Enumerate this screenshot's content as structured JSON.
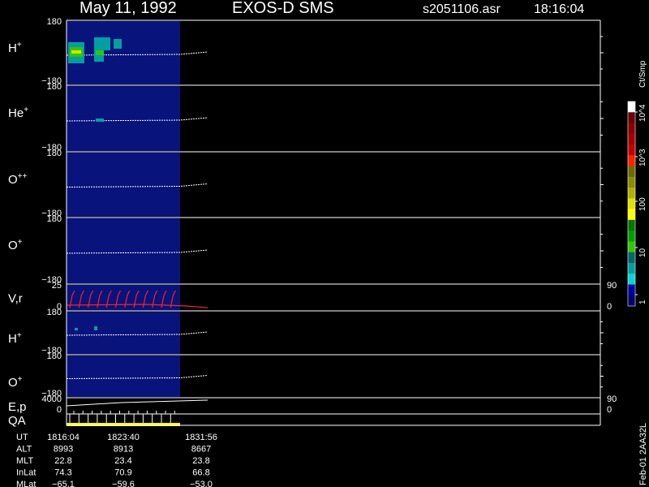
{
  "header": {
    "date": "May 11, 1992",
    "instrument": "EXOS-D SMS",
    "file": "s2051106.asr",
    "time": "18:16:04"
  },
  "colorbar": {
    "unit": "Ct/Smp",
    "ticks": [
      "10^4",
      "10^3",
      "100",
      "10",
      "1"
    ],
    "colors": [
      "#ffffff",
      "#6b0000",
      "#8c0000",
      "#a80000",
      "#c40000",
      "#ff2000",
      "#6b6b00",
      "#8c8c00",
      "#b0b000",
      "#e0e000",
      "#ffff00",
      "#007a00",
      "#00a000",
      "#30c800",
      "#006868",
      "#00a0a0",
      "#00d8d8",
      "#0000a0",
      "#00006a"
    ]
  },
  "colors": {
    "background": "#000000",
    "spectrogram_fill": "#08137c",
    "axis": "#ffffff",
    "velocity_trace": "#ff2020",
    "qa_bar": "#ffff00"
  },
  "chart_data": [
    {
      "type": "heatmap",
      "panel": "H+",
      "label": "H",
      "sup": "+",
      "ylim": [
        -180,
        180
      ],
      "ytick_top": "180",
      "ytick_bottom": "−180",
      "note_visible": "data only from 1816:04 to about 1821:00; high counts near 0°"
    },
    {
      "type": "heatmap",
      "panel": "He+",
      "label": "He",
      "sup": "+",
      "ylim": [
        -180,
        180
      ],
      "ytick_top": "180",
      "ytick_bottom": "−180"
    },
    {
      "type": "heatmap",
      "panel": "O++",
      "label": "O",
      "sup": "++",
      "ylim": [
        -180,
        180
      ],
      "ytick_top": "180",
      "ytick_bottom": "−180"
    },
    {
      "type": "heatmap",
      "panel": "O+",
      "label": "O",
      "sup": "+",
      "ylim": [
        -180,
        180
      ],
      "ytick_top": "180",
      "ytick_bottom": "−180"
    },
    {
      "type": "line",
      "panel": "V,r",
      "label": "V,r",
      "ylim": [
        0,
        25
      ],
      "ytick_top": "25",
      "ytick_bottom": "0",
      "right_ticks": [
        "90",
        "0"
      ]
    },
    {
      "type": "heatmap",
      "panel": "H+ (2)",
      "label": "H",
      "sup": "+",
      "ylim": [
        -180,
        180
      ],
      "ytick_top": "180",
      "ytick_bottom": "−180"
    },
    {
      "type": "heatmap",
      "panel": "O+ (2)",
      "label": "O",
      "sup": "+",
      "ylim": [
        -180,
        180
      ],
      "ytick_top": "180",
      "ytick_bottom": "−180"
    },
    {
      "type": "line",
      "panel": "E,p",
      "label": "E,p",
      "ylim": [
        0,
        4000
      ],
      "ytick_top": "4000",
      "ytick_bottom": "0",
      "right_ticks": [
        "90",
        "0"
      ]
    },
    {
      "type": "bar",
      "panel": "QA",
      "label": "QA"
    }
  ],
  "ephemeris": {
    "rows": [
      {
        "label": "UT",
        "values": [
          "1816:04",
          "1823:40",
          "1831:56"
        ]
      },
      {
        "label": "ALT",
        "values": [
          "8993",
          "8913",
          "8667"
        ]
      },
      {
        "label": "MLT",
        "values": [
          "22.8",
          "23.4",
          "23.8"
        ]
      },
      {
        "label": "InLat",
        "values": [
          "74.3",
          "70.9",
          "66.8"
        ]
      },
      {
        "label": "MLat",
        "values": [
          "−65.1",
          "−59.6",
          "−53.0"
        ]
      }
    ]
  },
  "side_label": "Feb-01 2AA32L"
}
